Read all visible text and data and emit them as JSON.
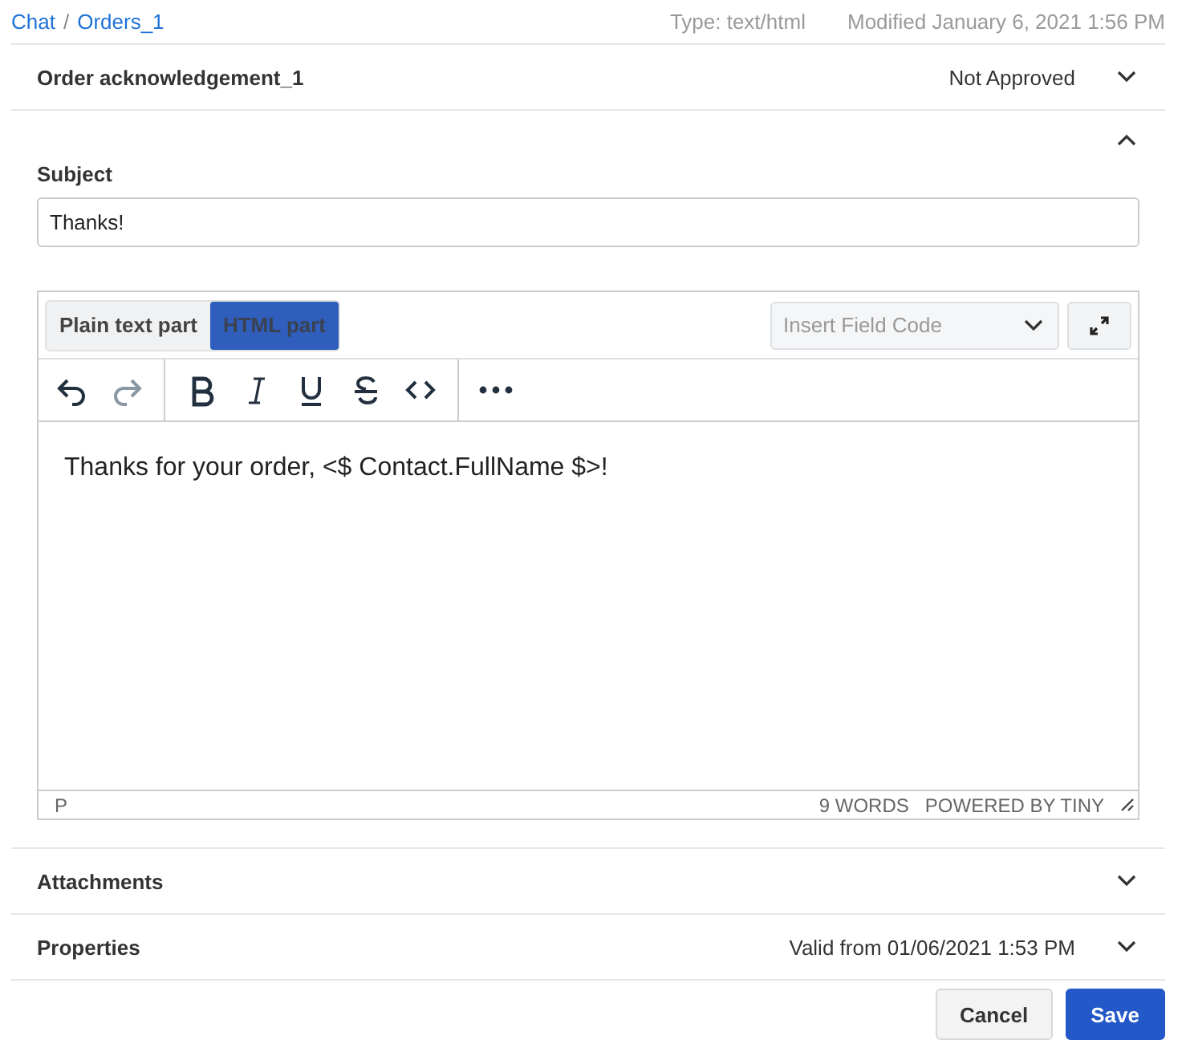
{
  "breadcrumb": [
    {
      "label": "Chat"
    },
    {
      "label": "Orders_1"
    }
  ],
  "breadcrumb_separator": "/",
  "type": "Type: text/html",
  "modified": "Modified January 6, 2021 1:56 PM",
  "header": {
    "title": "Order acknowledgement_1",
    "status": "Not Approved",
    "expanded": false
  },
  "content_section": {
    "expanded": true
  },
  "subject": {
    "label": "Subject",
    "value": "Thanks!"
  },
  "editor": {
    "tabs": [
      {
        "label": "Plain text part",
        "selected": false
      },
      {
        "label": "HTML part",
        "selected": true
      }
    ],
    "field_code": {
      "placeholder": "Insert Field Code"
    },
    "toolbar": [
      {
        "kind": "undo",
        "disabled": false
      },
      {
        "kind": "redo",
        "disabled": true
      },
      {
        "kind": "sep"
      },
      {
        "kind": "bold",
        "disabled": false
      },
      {
        "kind": "italic",
        "disabled": false
      },
      {
        "kind": "underline",
        "disabled": false
      },
      {
        "kind": "strike",
        "disabled": false
      },
      {
        "kind": "code",
        "disabled": false
      },
      {
        "kind": "sep"
      },
      {
        "kind": "more",
        "disabled": false
      }
    ],
    "body": "Thanks for your order, <$ Contact.FullName $>!",
    "path": "P",
    "word_count": "9 WORDS",
    "branding": "POWERED BY TINY"
  },
  "sections": [
    {
      "title": "Attachments",
      "expanded": false
    },
    {
      "title": "Properties",
      "summary": "Valid from 01/06/2021 1:53 PM",
      "expanded": false
    }
  ],
  "buttons": [
    {
      "label": "Cancel",
      "kind": "secondary"
    },
    {
      "label": "Save",
      "kind": "primary"
    }
  ]
}
